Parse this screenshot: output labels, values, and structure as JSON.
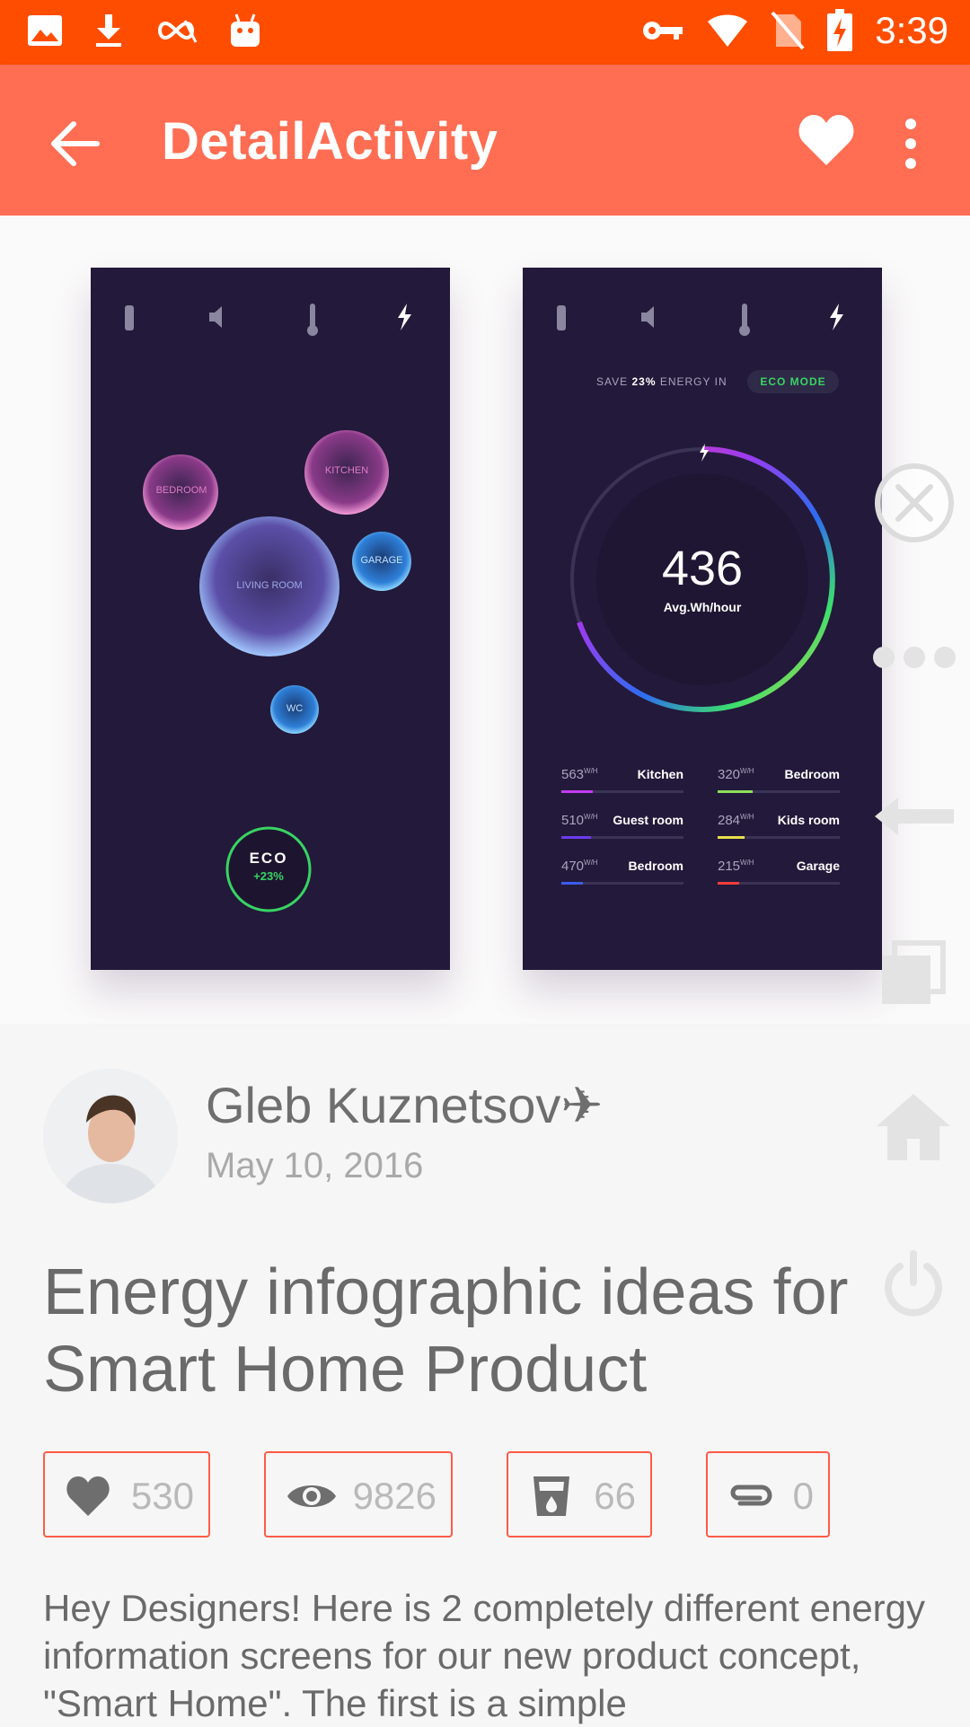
{
  "status_bar": {
    "icons": [
      "image-icon",
      "download-icon",
      "infinity-icon",
      "android-icon",
      "key-icon",
      "wifi-icon",
      "no-sim-icon",
      "battery-charging-icon"
    ],
    "time": "3:39"
  },
  "toolbar": {
    "title": "DetailActivity",
    "back_icon": "arrow-back-icon",
    "favorite_icon": "heart-icon",
    "menu_icon": "more-vert-icon",
    "color": "#ff6d52"
  },
  "hero": {
    "left_screen": {
      "bubbles": [
        "BEDROOM",
        "KITCHEN",
        "LIVING ROOM",
        "GARAGE",
        "WC"
      ],
      "eco_label": "ECO",
      "eco_value": "+23%"
    },
    "right_screen": {
      "save_prefix": "SAVE",
      "save_value": "23%",
      "save_suffix": "ENERGY IN",
      "mode_badge": "ECO MODE",
      "gauge_value": "436",
      "gauge_label": "Avg.Wh/hour",
      "rooms": [
        {
          "value": "563",
          "unit": "W/H",
          "name": "Kitchen",
          "color": "#c23cf0",
          "level": 0.26
        },
        {
          "value": "320",
          "unit": "W/H",
          "name": "Bedroom",
          "color": "#8de05a",
          "level": 0.29
        },
        {
          "value": "510",
          "unit": "W/H",
          "name": "Guest room",
          "color": "#6b3cf0",
          "level": 0.24
        },
        {
          "value": "284",
          "unit": "W/H",
          "name": "Kids room",
          "color": "#e8e049",
          "level": 0.22
        },
        {
          "value": "470",
          "unit": "W/H",
          "name": "Bedroom",
          "color": "#3c5cf0",
          "level": 0.18
        },
        {
          "value": "215",
          "unit": "W/H",
          "name": "Garage",
          "color": "#f03c3c",
          "level": 0.18
        }
      ]
    }
  },
  "floating_controls": [
    "close-circle-icon",
    "more-horiz-icon",
    "arrow-left-icon",
    "recent-apps-icon",
    "home-icon",
    "power-icon"
  ],
  "author": {
    "name": "Gleb Kuznetsov✈",
    "date": "May 10, 2016"
  },
  "post": {
    "title": "Energy infographic ideas for Smart Home Product",
    "description": "Hey Designers! Here is 2 completely different energy information screens for our new product concept, \"Smart Home\". The first is a simple"
  },
  "stats": [
    {
      "icon": "heart-icon",
      "value": "530"
    },
    {
      "icon": "eye-icon",
      "value": "9826"
    },
    {
      "icon": "bucket-icon",
      "value": "66"
    },
    {
      "icon": "paperclip-icon",
      "value": "0"
    }
  ],
  "colors": {
    "status_bar": "#ff4d00",
    "accent": "#ff5b48"
  }
}
